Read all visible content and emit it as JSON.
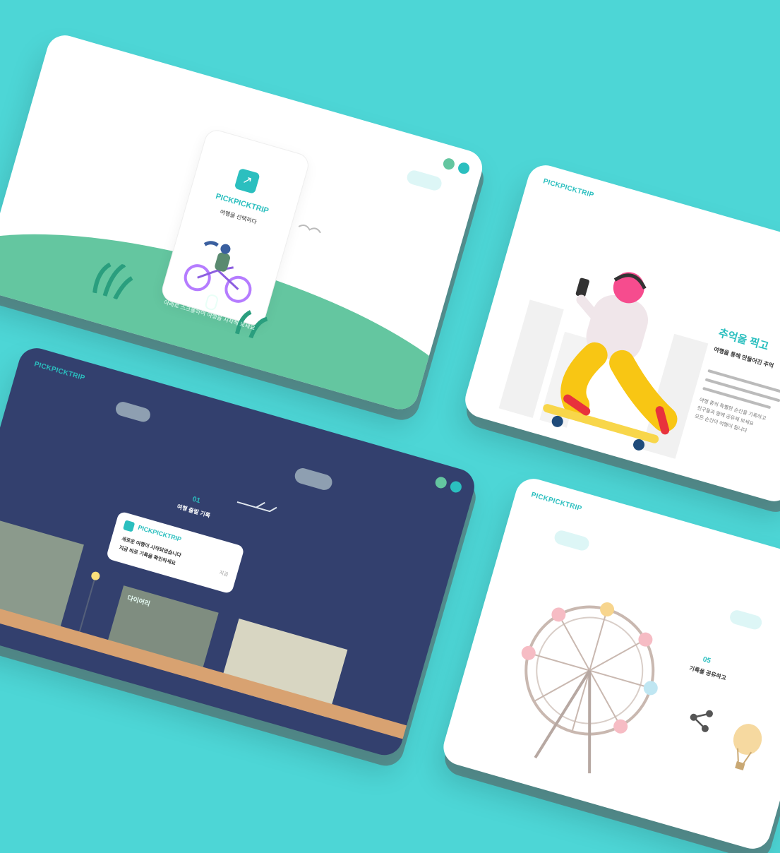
{
  "brand": "PICKPICKTRIP",
  "card_a": {
    "phone_title": "PICKPICKTRIP",
    "phone_sub": "여행을 선택하다",
    "hint": "아래로 스크롤하여 여행을 시작해 보세요",
    "logo_glyph": "↗"
  },
  "card_b": {
    "title": "추억을 찍고",
    "subtitle": "여행을 통해 만들어진 추억",
    "text_lines": [
      "여행 중의 특별한 순간을 기록하고",
      "친구들과 함께 공유해 보세요",
      "모든 순간이 여행이 됩니다"
    ]
  },
  "card_c": {
    "date": "01",
    "sub": "여행 출발 기록",
    "notif_title": "PICKPICKTRIP",
    "notif_time": "지금",
    "notif_lines": [
      "새로운 여행이 시작되었습니다",
      "지금 바로 기록을 확인하세요"
    ],
    "store_sign": "다이어리"
  },
  "card_d": {
    "date": "05",
    "sub": "기록을 공유하고"
  },
  "colors": {
    "background": "#4dd6d6",
    "accent": "#2bbfbf",
    "green": "#64c6a0",
    "navy": "#33406e"
  }
}
